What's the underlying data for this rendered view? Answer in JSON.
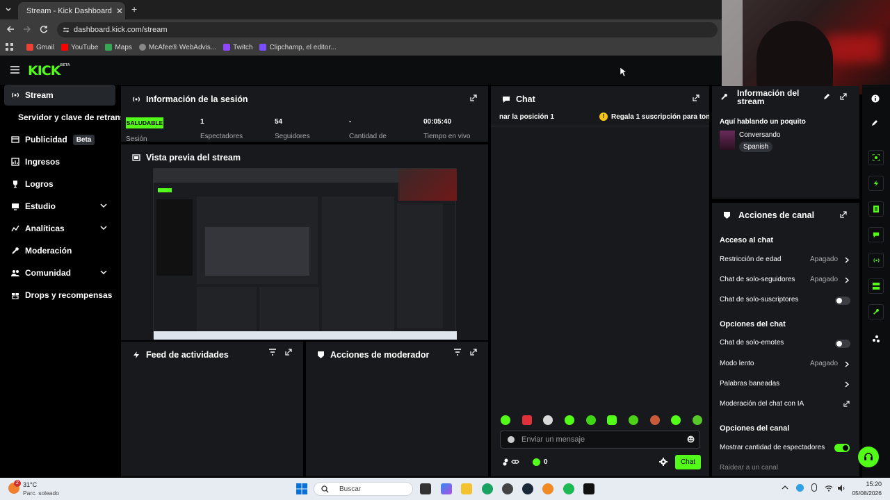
{
  "browser": {
    "tab_title": "Stream - Kick Dashboard",
    "url": "dashboard.kick.com/stream",
    "bookmarks": [
      "Gmail",
      "YouTube",
      "Maps",
      "McAfee® WebAdvis...",
      "Twitch",
      "Clipchamp, el editor..."
    ]
  },
  "header": {
    "logo": "KICK",
    "logo_sup": "BETA"
  },
  "sidebar": {
    "items": [
      {
        "label": "Stream"
      },
      {
        "label": "Servidor y clave de retransm"
      },
      {
        "label": "Publicidad",
        "badge": "Beta"
      },
      {
        "label": "Ingresos"
      },
      {
        "label": "Logros"
      },
      {
        "label": "Estudio"
      },
      {
        "label": "Analíticas"
      },
      {
        "label": "Moderación"
      },
      {
        "label": "Comunidad"
      },
      {
        "label": "Drops y recompensas"
      }
    ]
  },
  "session": {
    "title": "Información de la sesión",
    "status": "SALUDABLE",
    "status_label": "Sesión",
    "stats": [
      {
        "value": "1",
        "label": "Espectadores"
      },
      {
        "value": "54",
        "label": "Seguidores"
      },
      {
        "value": "-",
        "label": "Cantidad de"
      },
      {
        "value": "00:05:40",
        "label": "Tiempo en vivo"
      }
    ]
  },
  "preview": {
    "title": "Vista previa del stream"
  },
  "feed": {
    "title": "Feed de actividades"
  },
  "modactions": {
    "title": "Acciones de moderador"
  },
  "chat": {
    "title": "Chat",
    "ticker_left": "nar la posición 1",
    "ticker_right": "Regala 1 suscripción para ton",
    "placeholder": "Enviar un mensaje",
    "kick_count": "0",
    "send_label": "Chat"
  },
  "stream_info": {
    "title": "Información del stream",
    "stream_title": "Aquí hablando un poquito",
    "category": "Conversando",
    "language": "Spanish"
  },
  "channel_actions": {
    "title": "Acciones de canal",
    "sections": [
      {
        "heading": "Acceso al chat"
      },
      {
        "heading": "Opciones del chat"
      },
      {
        "heading": "Opciones del canal"
      }
    ],
    "rows": {
      "age": {
        "label": "Restricción de edad",
        "value": "Apagado"
      },
      "followers": {
        "label": "Chat de solo-seguidores",
        "value": "Apagado"
      },
      "subs": {
        "label": "Chat de solo-suscriptores"
      },
      "emotes": {
        "label": "Chat de solo-emotes"
      },
      "slow": {
        "label": "Modo lento",
        "value": "Apagado"
      },
      "banned": {
        "label": "Palabras baneadas"
      },
      "ai": {
        "label": "Moderación del chat con IA"
      },
      "viewer_count": {
        "label": "Mostrar cantidad de espectadores"
      },
      "raid": {
        "label": "Raidear a un canal"
      }
    },
    "toggles": {
      "subs": false,
      "emotes": false,
      "viewer_count": true
    }
  },
  "taskbar": {
    "weather_temp": "31°C",
    "weather_desc": "Parc. soleado",
    "search_placeholder": "Buscar",
    "time": "15:20",
    "date": "05/08/2026",
    "notification_count": "2"
  },
  "colors": {
    "accent": "#53fc18",
    "panel": "#18191c",
    "background": "#000000"
  }
}
